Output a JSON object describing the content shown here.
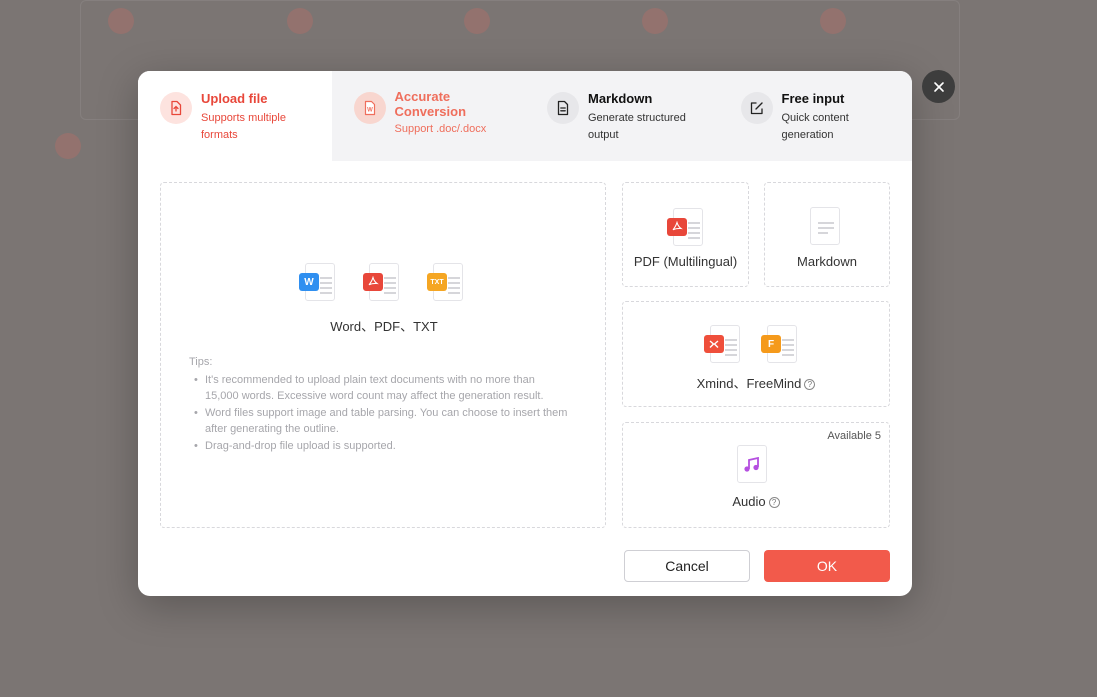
{
  "tabs": [
    {
      "title": "Upload file",
      "subtitle": "Supports multiple formats",
      "icon": "upload-file-icon"
    },
    {
      "title": "Accurate Conversion",
      "subtitle": "Support .doc/.docx",
      "icon": "word-doc-icon"
    },
    {
      "title": "Markdown",
      "subtitle": "Generate structured output",
      "icon": "document-icon"
    },
    {
      "title": "Free input",
      "subtitle": "Quick content generation",
      "icon": "edit-icon"
    }
  ],
  "dropzone": {
    "label": "Word、PDF、TXT",
    "badges": {
      "word": "W",
      "txt": "TXT"
    },
    "tips_title": "Tips:",
    "tips": [
      "It's recommended to upload plain text documents with no more than 15,000 words. Excessive word count may affect the generation result.",
      "Word files support image and table parsing. You can choose to insert them after generating the outline.",
      "Drag-and-drop file upload is supported."
    ]
  },
  "cards": {
    "pdf": {
      "label": "PDF (Multilingual)"
    },
    "markdown": {
      "label": "Markdown"
    },
    "xmind": {
      "label": "Xmind、FreeMind",
      "badge_f": "F"
    },
    "audio": {
      "label": "Audio",
      "available": "Available 5"
    }
  },
  "buttons": {
    "cancel": "Cancel",
    "ok": "OK"
  },
  "colors": {
    "accent": "#f25a4b",
    "word": "#2f8ff0",
    "pdf": "#e8473a",
    "txt": "#f5a623",
    "xmind": "#ef4f3b",
    "freemind": "#f59a1b",
    "audio": "#b54fe0"
  }
}
